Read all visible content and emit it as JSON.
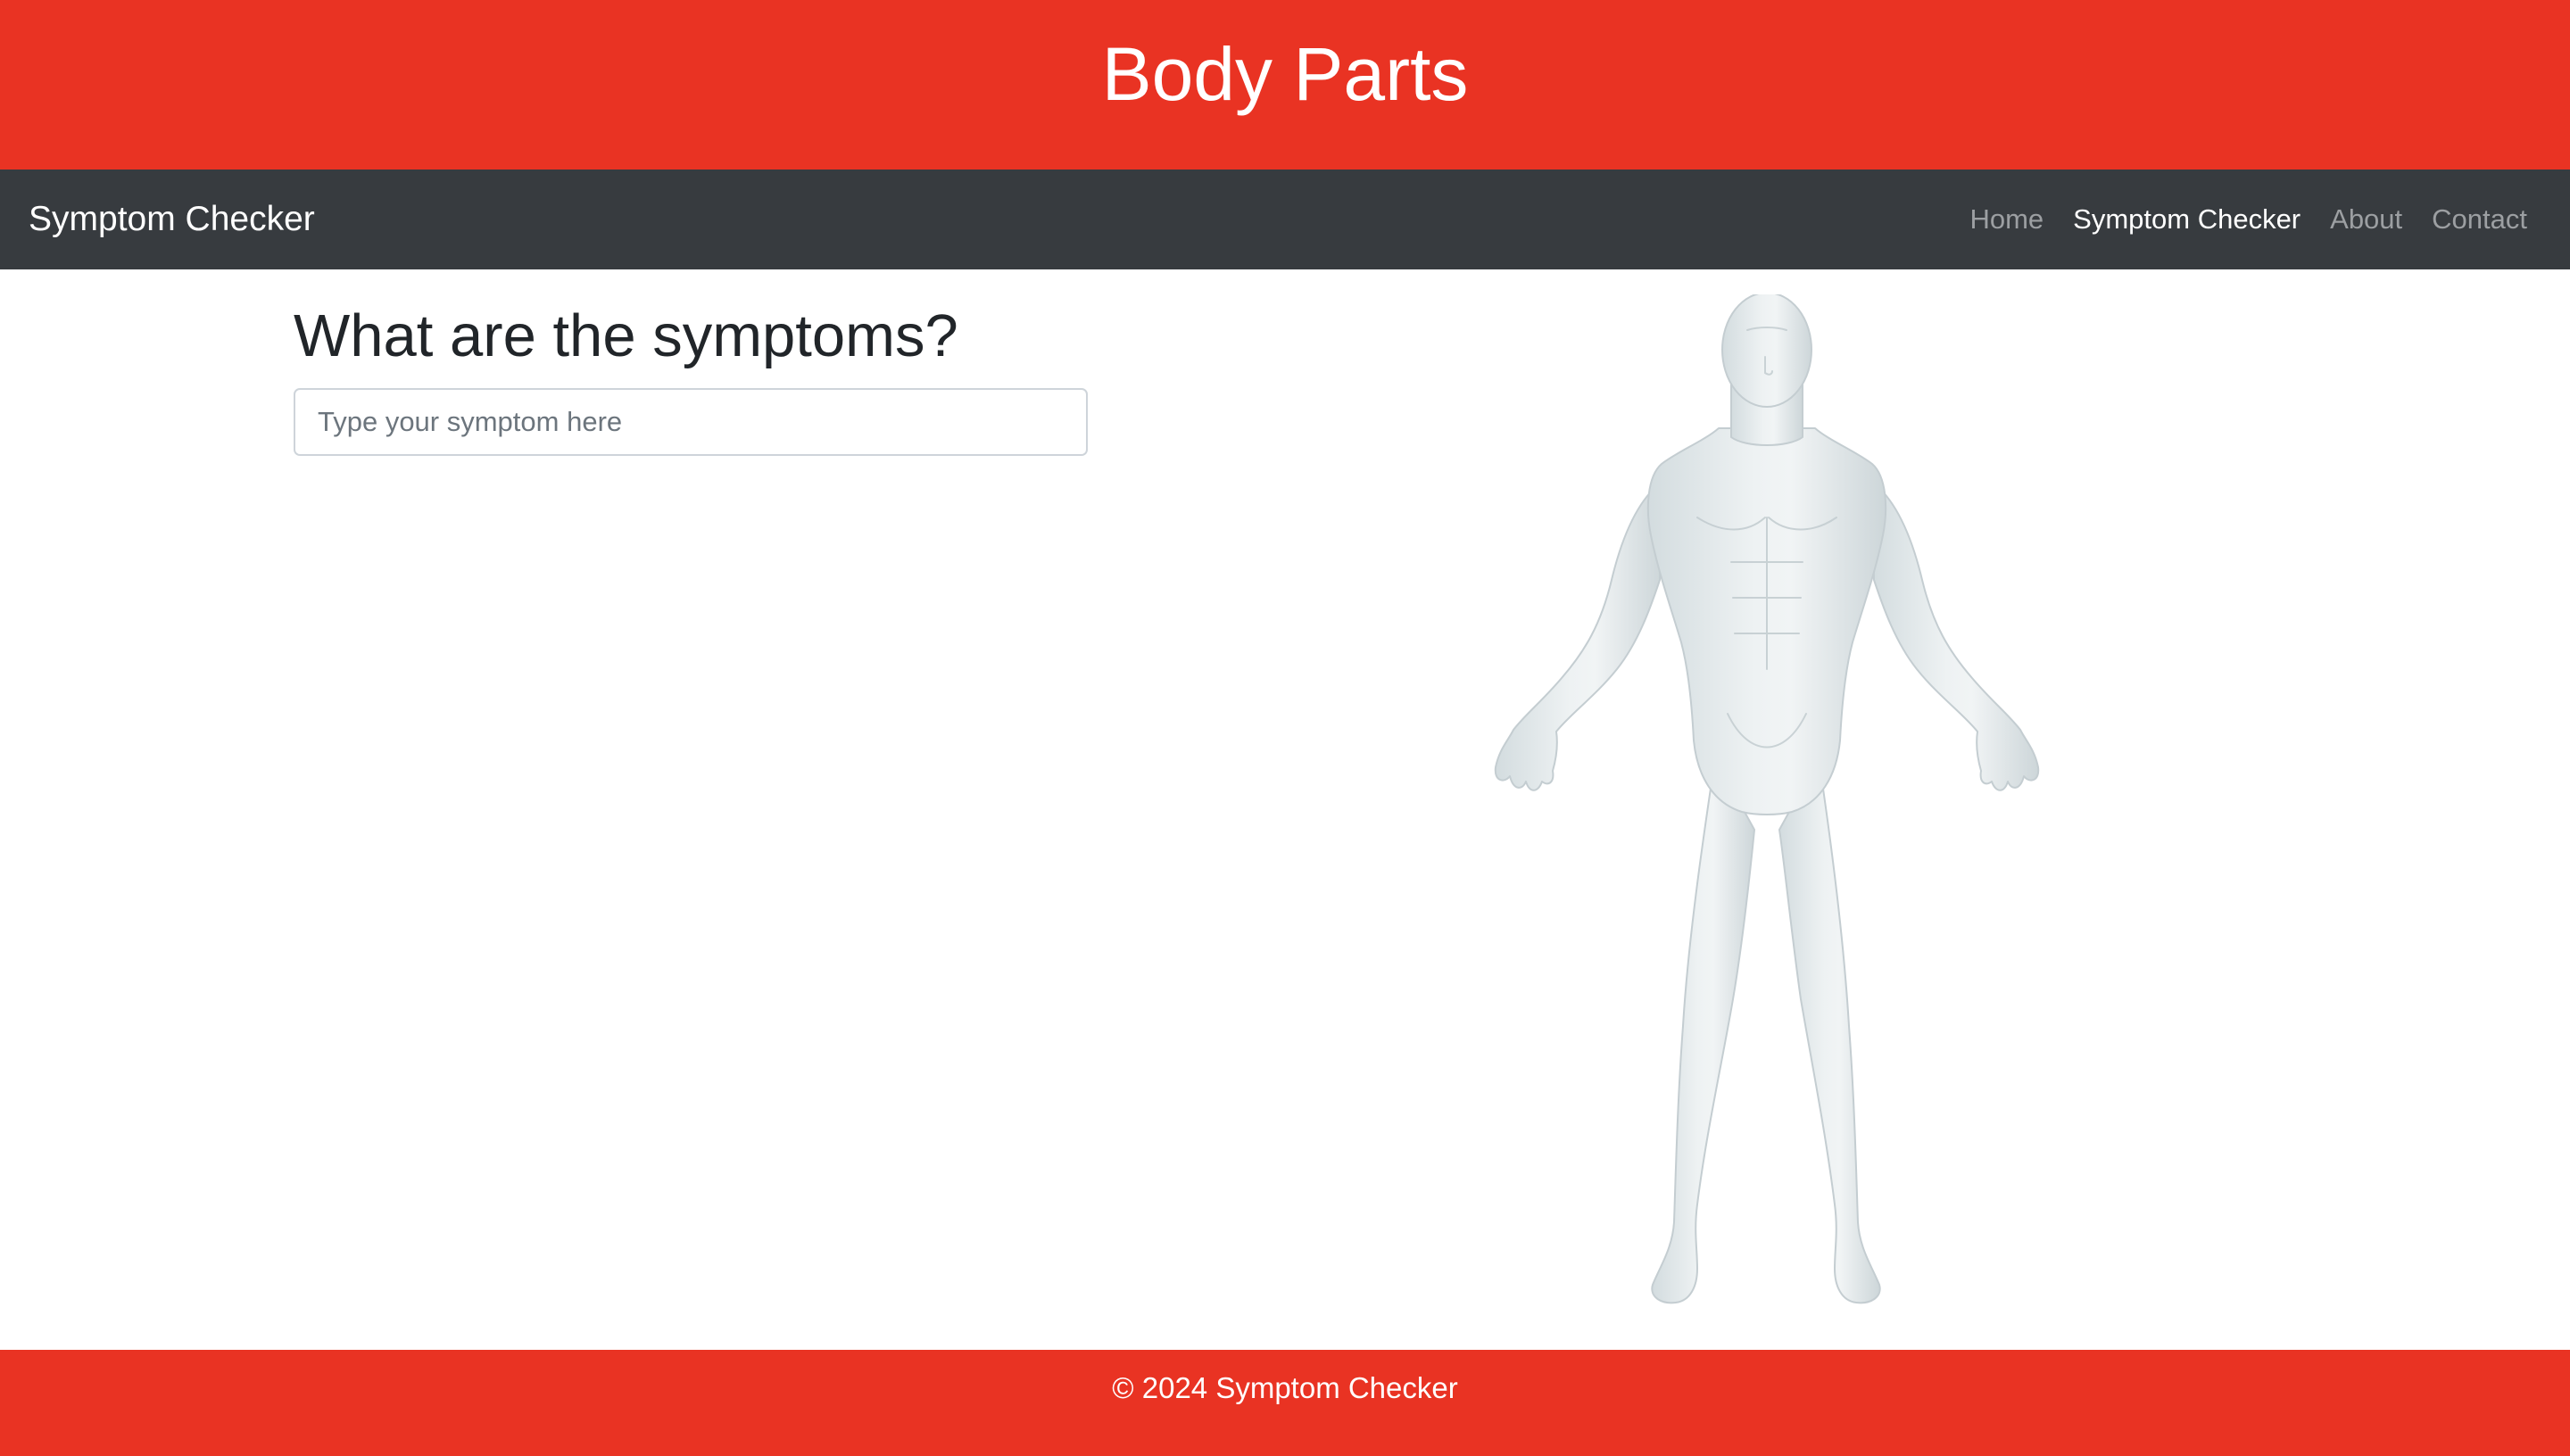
{
  "header": {
    "title": "Body Parts"
  },
  "navbar": {
    "brand": "Symptom Checker",
    "links": [
      {
        "label": "Home",
        "active": false
      },
      {
        "label": "Symptom Checker",
        "active": true
      },
      {
        "label": "About",
        "active": false
      },
      {
        "label": "Contact",
        "active": false
      }
    ]
  },
  "main": {
    "question": "What are the symptoms?",
    "symptom_input": {
      "value": "",
      "placeholder": "Type your symptom here"
    },
    "figure_icon": "human-body-figure"
  },
  "footer": {
    "text": "© 2024 Symptom Checker"
  },
  "colors": {
    "brand_red": "#e93323",
    "navbar_dark": "#373b3f",
    "nav_inactive": "#9c9fa2",
    "nav_active": "#ffffff",
    "body_figure": "#e4eaec"
  }
}
